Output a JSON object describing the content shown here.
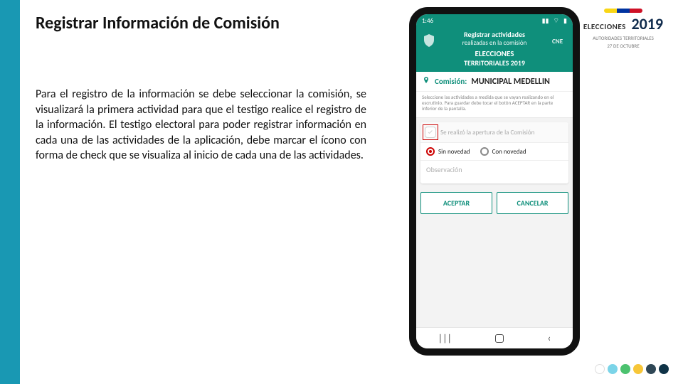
{
  "title": "Registrar Información de Comisión",
  "paragraph": "Para el registro de la información se debe seleccionar la comisión, se visualizará la primera actividad para que el testigo realice el registro de la información. El testigo electoral para poder registrar información en cada una de las actividades de la aplicación, debe marcar el ícono con forma de check que se visualiza al inicio de cada una de las actividades.",
  "logo": {
    "word": "ELECCIONES",
    "year": "2019",
    "subtitle": "AUTORIDADES TERRITORIALES",
    "date": "27 DE OCTUBRE",
    "flag": [
      "#f9d616",
      "#0033a0",
      "#ce1126"
    ]
  },
  "phone": {
    "status": {
      "time": "1:46",
      "icons": [
        "ntw",
        "wifi",
        "batt"
      ]
    },
    "header": {
      "line1": "Registrar actividades",
      "line2": "realizadas en la comisión",
      "sub1": "ELECCIONES",
      "sub2": "TERRITORIALES 2019",
      "emblem_right": "CNE"
    },
    "comision": {
      "label": "Comisión:",
      "value": "MUNICIPAL MEDELLIN"
    },
    "instruction": "Seleccione las actividades a medida que se vayan realizando en el escrutinio. Para guardar debe tocar el botón ACEPTAR en la parte inferior de la pantalla.",
    "activity": {
      "title": "Se realizó la apertura de la Comisión",
      "radios": {
        "sin": "Sin novedad",
        "con": "Con novedad"
      },
      "selected": "sin",
      "obs_placeholder": "Observación"
    },
    "buttons": {
      "accept": "ACEPTAR",
      "cancel": "CANCELAR"
    },
    "nav": {
      "recent": "|||",
      "home": "home-icon",
      "back": "‹"
    }
  },
  "palette": {
    "dots": [
      "#ffffff00",
      "#7bd4e8",
      "#4cc26f",
      "#f7c638",
      "#2f4756",
      "#0f3347"
    ]
  }
}
